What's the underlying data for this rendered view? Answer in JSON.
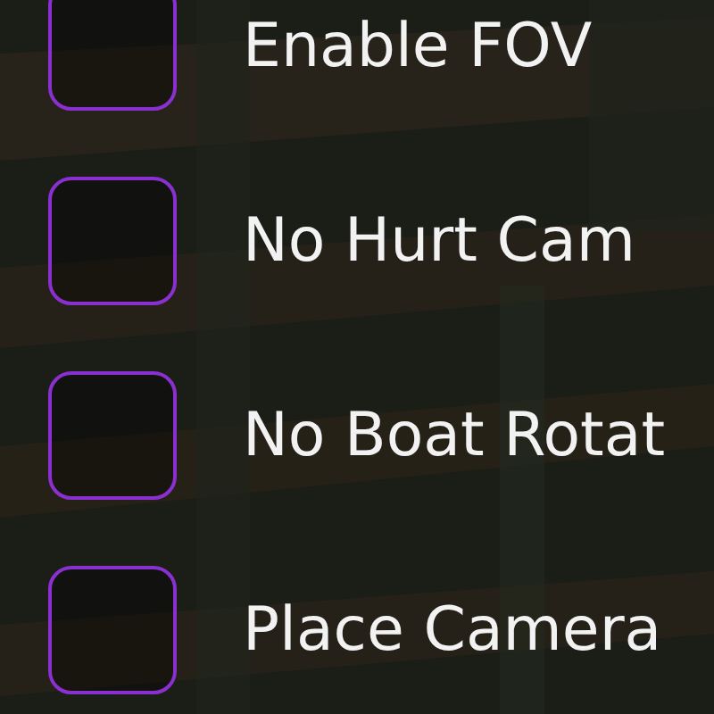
{
  "options": [
    {
      "label": "Enable FOV",
      "checked": false
    },
    {
      "label": "No Hurt Cam",
      "checked": false
    },
    {
      "label": "No Boat Rotat",
      "checked": false
    },
    {
      "label": "Place Camera",
      "checked": false
    }
  ]
}
